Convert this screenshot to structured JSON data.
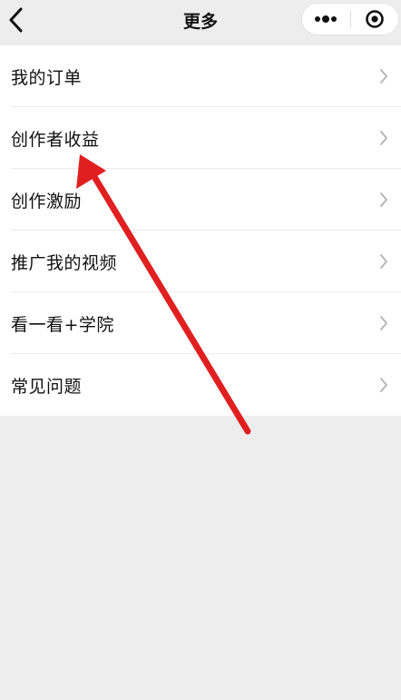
{
  "header": {
    "title": "更多",
    "back_icon": "chevron-left-icon",
    "more_icon": "more-dots-icon",
    "close_icon": "target-close-icon"
  },
  "menu": {
    "items": [
      {
        "label": "我的订单"
      },
      {
        "label": "创作者收益"
      },
      {
        "label": "创作激励"
      },
      {
        "label": "推广我的视频"
      },
      {
        "label": "看一看+学院"
      },
      {
        "label": "常见问题"
      }
    ]
  },
  "annotation": {
    "arrow_color": "#e02020",
    "points_to": "创作者收益"
  },
  "colors": {
    "background": "#ededed",
    "list_background": "#ffffff",
    "text": "#111111",
    "chevron": "#b2b2b2"
  }
}
